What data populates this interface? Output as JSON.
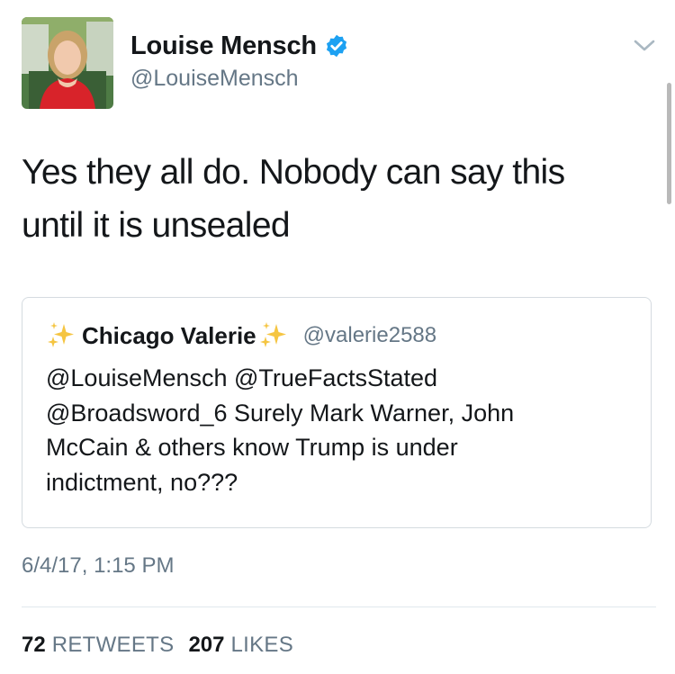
{
  "tweet": {
    "author": {
      "display_name": "Louise Mensch",
      "handle": "@LouiseMensch",
      "verified": true,
      "verified_color": "#1da1f2"
    },
    "text_lines": [
      "Yes they all do. Nobody can say this",
      "until it is unsealed"
    ],
    "timestamp": "6/4/17, 1:15 PM",
    "stats": {
      "retweets_count": "72",
      "retweets_label": "RETWEETS",
      "likes_count": "207",
      "likes_label": "LIKES"
    }
  },
  "quoted_tweet": {
    "display_name": "Chicago Valerie",
    "handle": "@valerie2588",
    "text_lines": [
      "@LouiseMensch @TrueFactsStated",
      "@Broadsword_6 Surely Mark Warner, John",
      "McCain & others know Trump is under",
      "indictment, no???"
    ]
  },
  "icons": {
    "avatar": "profile-photo",
    "verified": "verified-badge-icon",
    "menu": "chevron-down-icon",
    "sparkles": "sparkles-icon"
  },
  "colors": {
    "text_primary": "#14171a",
    "text_secondary": "#657786",
    "border": "#d5dbe0",
    "sparkle": "#f5c542"
  }
}
